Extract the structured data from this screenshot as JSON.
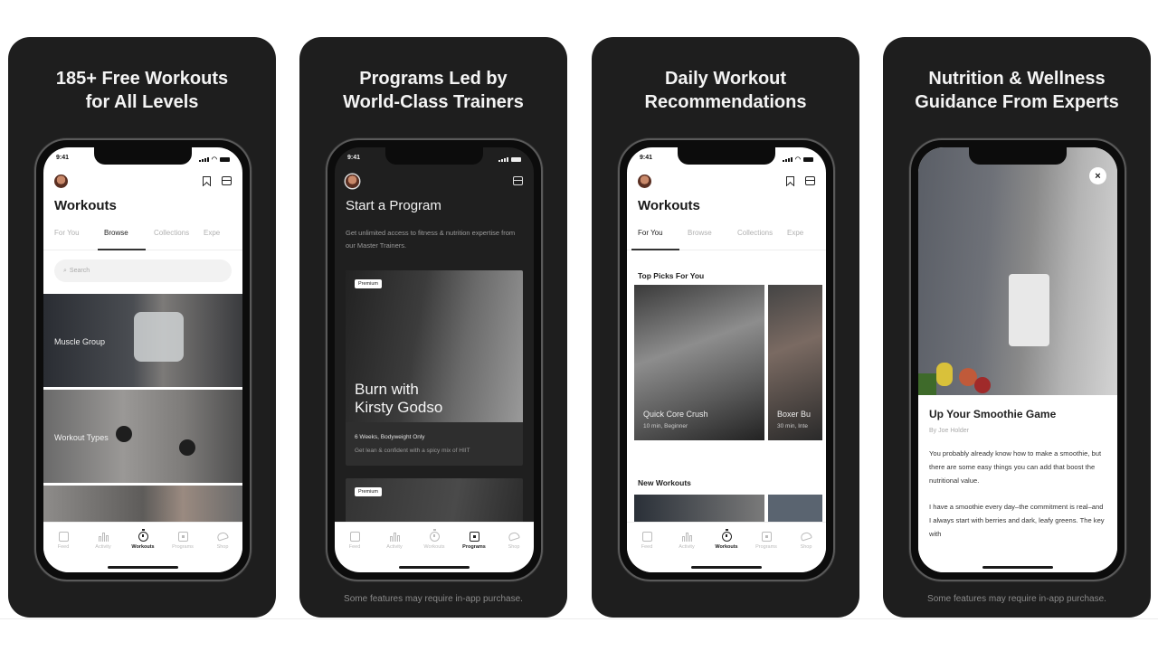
{
  "panels": [
    {
      "title_line1": "185+ Free Workouts",
      "title_line2": "for All Levels",
      "footer": "",
      "screen": {
        "time": "9:41",
        "title": "Workouts",
        "tabs": [
          "For You",
          "Browse",
          "Collections",
          "Expe"
        ],
        "active_tab": "Browse",
        "search_placeholder": "Search",
        "tiles": [
          "Muscle Group",
          "Workout Types",
          ""
        ],
        "tabbar": [
          "Feed",
          "Activity",
          "Workouts",
          "Programs",
          "Shop"
        ],
        "active_tabbar": "Workouts"
      }
    },
    {
      "title_line1": "Programs Led by",
      "title_line2": "World-Class Trainers",
      "footer": "Some features may require in-app purchase.",
      "screen": {
        "time": "9:41",
        "title": "Start a Program",
        "subtitle": "Get unlimited access to fitness & nutrition expertise from our Master Trainers.",
        "program": {
          "badge": "Premium",
          "name_line1": "Burn with",
          "name_line2": "Kirsty Godso",
          "meta": "6 Weeks, Bodyweight Only",
          "desc": "Get lean & confident with a spicy mix of HIIT"
        },
        "next_badge": "Premium",
        "tabbar": [
          "Feed",
          "Activity",
          "Workouts",
          "Programs",
          "Shop"
        ],
        "active_tabbar": "Programs"
      }
    },
    {
      "title_line1": "Daily Workout",
      "title_line2": "Recommendations",
      "footer": "",
      "screen": {
        "time": "9:41",
        "title": "Workouts",
        "tabs": [
          "For You",
          "Browse",
          "Collections",
          "Expe"
        ],
        "active_tab": "For You",
        "section1": "Top Picks For You",
        "picks": [
          {
            "title": "Quick Core Crush",
            "sub": "10 min, Beginner"
          },
          {
            "title": "Boxer Bu",
            "sub": "30 min, Inte"
          }
        ],
        "section2": "New Workouts",
        "tabbar": [
          "Feed",
          "Activity",
          "Workouts",
          "Programs",
          "Shop"
        ],
        "active_tabbar": "Workouts"
      }
    },
    {
      "title_line1": "Nutrition & Wellness",
      "title_line2": "Guidance From Experts",
      "footer": "Some features may require in-app purchase.",
      "screen": {
        "close_label": "×",
        "article_title": "Up Your Smoothie Game",
        "byline": "By Joe Holder",
        "para1": "You probably already know how to make a smoothie, but there are some easy things you can add that boost the nutritional value.",
        "para2": "I have a smoothie every day–the commitment is real–and I always start with berries and dark, leafy greens. The key with"
      }
    }
  ],
  "colors": {
    "card_bg": "#1e1e1e",
    "title_text": "#f4f4f4",
    "footer_text": "#8a8a8a"
  }
}
